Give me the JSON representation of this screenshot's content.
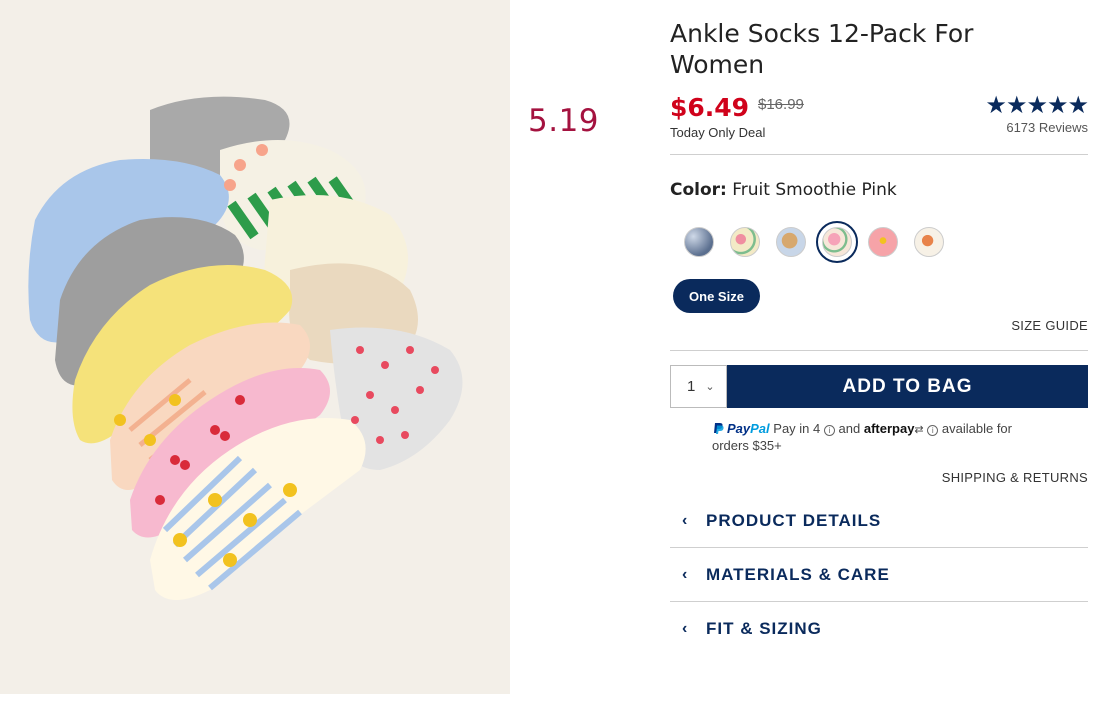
{
  "overlay": {
    "number": "5.19"
  },
  "product": {
    "title": "Ankle Socks 12-Pack For Women",
    "price": "$6.49",
    "original_price": "$16.99",
    "deal_label": "Today Only Deal",
    "rating_stars": "★★★★★",
    "reviews": "6173 Reviews",
    "color_label": "Color:",
    "color_value": "Fruit Smoothie Pink",
    "swatches": [
      {
        "name": "blue-paisley",
        "selected": false
      },
      {
        "name": "floral-yellow",
        "selected": false
      },
      {
        "name": "dog-print",
        "selected": false
      },
      {
        "name": "fruit-smoothie-pink",
        "selected": true
      },
      {
        "name": "pink-floral",
        "selected": false
      },
      {
        "name": "orange-pattern",
        "selected": false
      }
    ],
    "size_button": "One Size",
    "size_guide": "SIZE GUIDE",
    "quantity": "1",
    "add_to_bag": "ADD TO BAG",
    "paypal": {
      "logo_pay": "Pay",
      "logo_pal": "Pal",
      "text_before": "Pay in 4",
      "and": "and",
      "afterpay": "afterpay",
      "text_after": "available for orders $35+"
    },
    "shipping_returns": "SHIPPING & RETURNS",
    "accordions": [
      {
        "label": "PRODUCT DETAILS"
      },
      {
        "label": "MATERIALS & CARE"
      },
      {
        "label": "FIT & SIZING"
      }
    ]
  },
  "colors": {
    "navy": "#0a2a5c",
    "sale_red": "#d0021b",
    "overlay_red": "#a4123f"
  }
}
